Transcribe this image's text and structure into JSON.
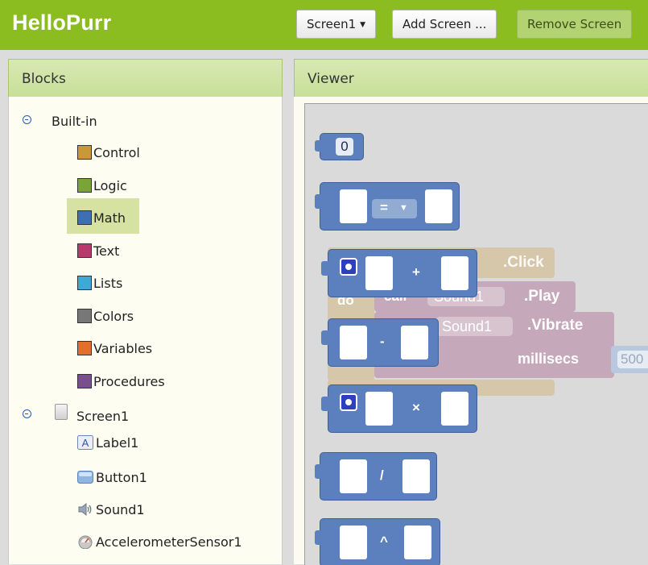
{
  "app": {
    "title": "HelloPurr"
  },
  "toolbar": {
    "screen_select": "Screen1",
    "add_screen": "Add Screen ...",
    "remove_screen": "Remove Screen"
  },
  "blocks_panel": {
    "title": "Blocks",
    "builtin_label": "Built-in",
    "categories": [
      {
        "label": "Control",
        "color": "#c8983a"
      },
      {
        "label": "Logic",
        "color": "#79a538"
      },
      {
        "label": "Math",
        "color": "#3e6fb3"
      },
      {
        "label": "Text",
        "color": "#b83a6c"
      },
      {
        "label": "Lists",
        "color": "#3fa9d6"
      },
      {
        "label": "Colors",
        "color": "#777777"
      },
      {
        "label": "Variables",
        "color": "#e0712c"
      },
      {
        "label": "Procedures",
        "color": "#7b4e8e"
      }
    ],
    "screen_label": "Screen1",
    "components": [
      {
        "label": "Label1",
        "icon": "label-icon"
      },
      {
        "label": "Button1",
        "icon": "button-icon"
      },
      {
        "label": "Sound1",
        "icon": "sound-icon"
      },
      {
        "label": "AccelerometerSensor1",
        "icon": "accelerometer-icon"
      }
    ]
  },
  "viewer": {
    "title": "Viewer",
    "ghost_blocks": {
      "click_event": ".Click",
      "do_label": "do",
      "call_label": "call",
      "sound_dropdown": "Sound1",
      "play_method": ".Play",
      "vibrate_method": ".Vibrate",
      "millisecs_label": "millisecs",
      "number_value": "500"
    },
    "math_blocks": {
      "number_value": "0",
      "compare_op": "=",
      "add_op": "+",
      "subtract_op": "-",
      "multiply_op": "×",
      "divide_op": "/",
      "power_op": "^"
    }
  }
}
